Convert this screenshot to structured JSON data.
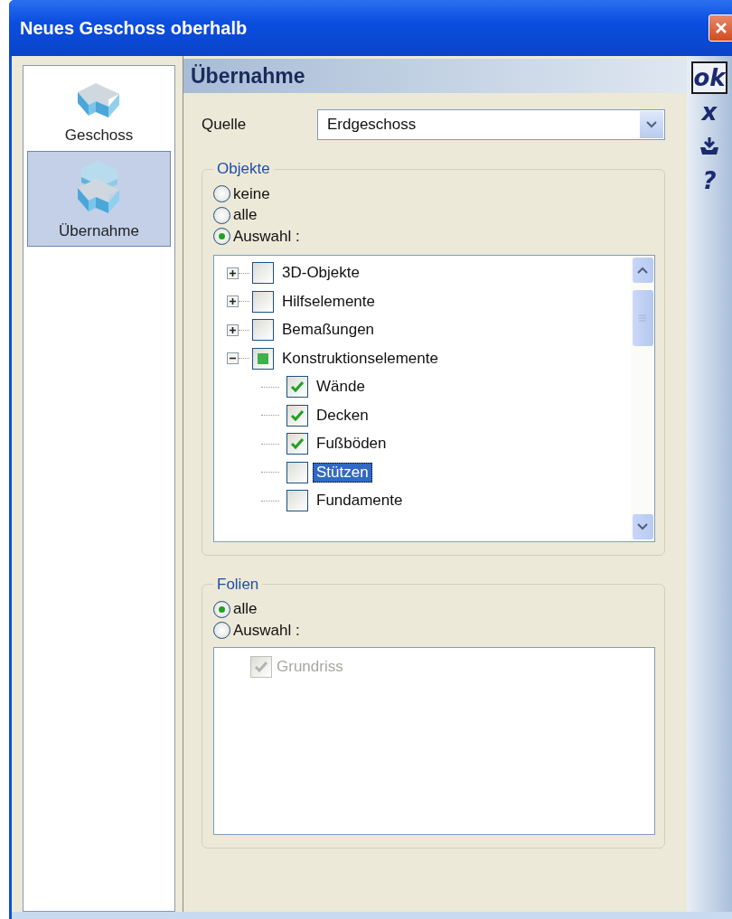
{
  "window": {
    "title": "Neues Geschoss oberhalb"
  },
  "sidebar": {
    "items": [
      {
        "label": "Geschoss",
        "selected": false
      },
      {
        "label": "Übernahme",
        "selected": true
      }
    ]
  },
  "panel": {
    "title": "Übernahme",
    "source": {
      "label": "Quelle",
      "value": "Erdgeschoss"
    },
    "objects": {
      "title": "Objekte",
      "options": [
        {
          "label": "keine",
          "selected": false
        },
        {
          "label": "alle",
          "selected": false
        },
        {
          "label": "Auswahl :",
          "selected": true
        }
      ],
      "tree": [
        {
          "label": "3D-Objekte",
          "expanded": false,
          "checked": false,
          "indeterminate": false,
          "selected": false
        },
        {
          "label": "Hilfselemente",
          "expanded": false,
          "checked": false,
          "indeterminate": false,
          "selected": false
        },
        {
          "label": "Bemaßungen",
          "expanded": false,
          "checked": false,
          "indeterminate": false,
          "selected": false
        },
        {
          "label": "Konstruktionselemente",
          "expanded": true,
          "checked": false,
          "indeterminate": true,
          "selected": false,
          "children": [
            {
              "label": "Wände",
              "checked": true,
              "selected": false
            },
            {
              "label": "Decken",
              "checked": true,
              "selected": false
            },
            {
              "label": "Fußböden",
              "checked": true,
              "selected": false
            },
            {
              "label": "Stützen",
              "checked": false,
              "selected": true
            },
            {
              "label": "Fundamente",
              "checked": false,
              "selected": false
            }
          ]
        }
      ]
    },
    "layers": {
      "title": "Folien",
      "options": [
        {
          "label": "alle",
          "selected": true
        },
        {
          "label": "Auswahl :",
          "selected": false
        }
      ],
      "list": [
        {
          "label": "Grundriss",
          "checked": true,
          "disabled": true
        }
      ]
    }
  },
  "toolbar": [
    {
      "kind": "text",
      "label": "ok",
      "selected": true
    },
    {
      "kind": "text",
      "label": "x",
      "selected": false
    },
    {
      "kind": "anchor",
      "selected": false
    },
    {
      "kind": "text",
      "label": "?",
      "selected": false
    }
  ]
}
